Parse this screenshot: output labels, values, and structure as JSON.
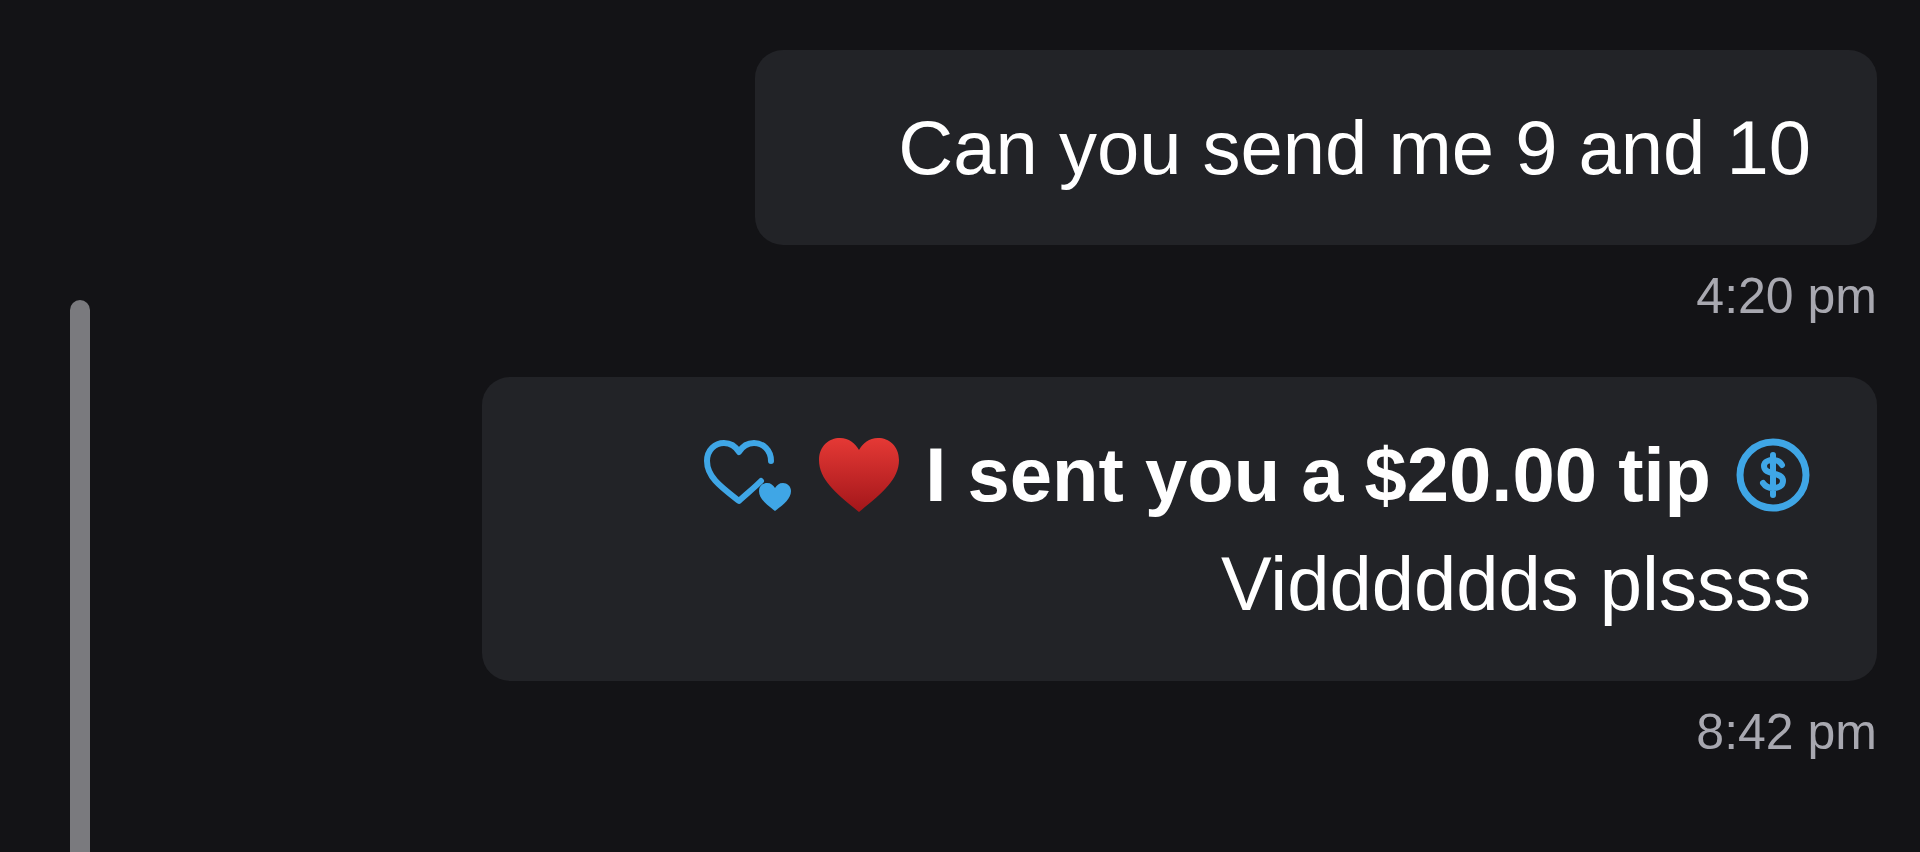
{
  "messages": [
    {
      "kind": "text",
      "text": "Can you send me 9 and 10",
      "time": "4:20 pm"
    },
    {
      "kind": "tip",
      "tip_text": "I sent you a $20.00 tip",
      "text": "Vidddddds plssss",
      "time": "8:42 pm"
    }
  ]
}
